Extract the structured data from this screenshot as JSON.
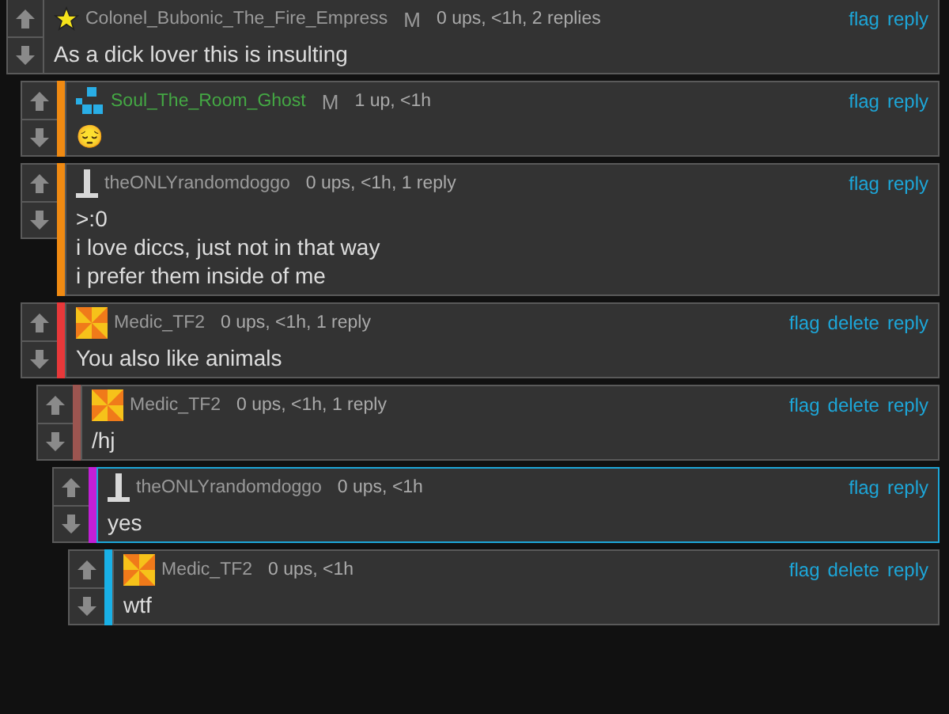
{
  "comments": [
    {
      "avatar": {
        "kind": "star"
      },
      "username": {
        "text": "Colonel_Bubonic_The_Fire_Empress",
        "color": "#9a9a9a"
      },
      "badge": "M",
      "meta": "0 ups, <1h, 2 replies",
      "actions": [
        "flag",
        "reply"
      ],
      "highlighted": false,
      "lines": [
        "As a dick lover this is insulting"
      ],
      "children": [
        {
          "avatar": {
            "kind": "tiles"
          },
          "username": {
            "text": "Soul_The_Room_Ghost",
            "color": "#44a844"
          },
          "badge": "M",
          "meta": "1 up, <1h",
          "actions": [
            "flag",
            "reply"
          ],
          "highlighted": false,
          "color": "#f08a12",
          "lines": [
            "😔"
          ]
        },
        {
          "avatar": {
            "kind": "pole"
          },
          "username": {
            "text": "theONLYrandomdoggo",
            "color": "#9a9a9a"
          },
          "meta": "0 ups, <1h, 1 reply",
          "actions": [
            "flag",
            "reply"
          ],
          "highlighted": false,
          "color": "#f08a12",
          "lines": [
            ">:0",
            "i love diccs, just not in that way",
            "i prefer them inside of me"
          ],
          "children": [
            {
              "avatar": {
                "kind": "pinwheel"
              },
              "username": {
                "text": "Medic_TF2",
                "color": "#9a9a9a"
              },
              "meta": "0 ups, <1h, 1 reply",
              "actions": [
                "flag",
                "delete",
                "reply"
              ],
              "highlighted": false,
              "color": "#e8383a",
              "lines": [
                "You also like animals"
              ],
              "children": [
                {
                  "avatar": {
                    "kind": "pinwheel"
                  },
                  "username": {
                    "text": "Medic_TF2",
                    "color": "#9a9a9a"
                  },
                  "meta": "0 ups, <1h, 1 reply",
                  "actions": [
                    "flag",
                    "delete",
                    "reply"
                  ],
                  "highlighted": false,
                  "color": "#9c5550",
                  "lines": [
                    "/hj"
                  ],
                  "children": [
                    {
                      "avatar": {
                        "kind": "pole"
                      },
                      "username": {
                        "text": "theONLYrandomdoggo",
                        "color": "#9a9a9a"
                      },
                      "meta": "0 ups, <1h",
                      "actions": [
                        "flag",
                        "reply"
                      ],
                      "highlighted": true,
                      "color": "#c21fd6",
                      "lines": [
                        "yes"
                      ],
                      "children": [
                        {
                          "avatar": {
                            "kind": "pinwheel"
                          },
                          "username": {
                            "text": "Medic_TF2",
                            "color": "#9a9a9a"
                          },
                          "meta": "0 ups, <1h",
                          "actions": [
                            "flag",
                            "delete",
                            "reply"
                          ],
                          "highlighted": false,
                          "color": "#19b0e6",
                          "lines": [
                            "wtf"
                          ]
                        }
                      ]
                    }
                  ]
                }
              ]
            }
          ]
        }
      ]
    }
  ]
}
